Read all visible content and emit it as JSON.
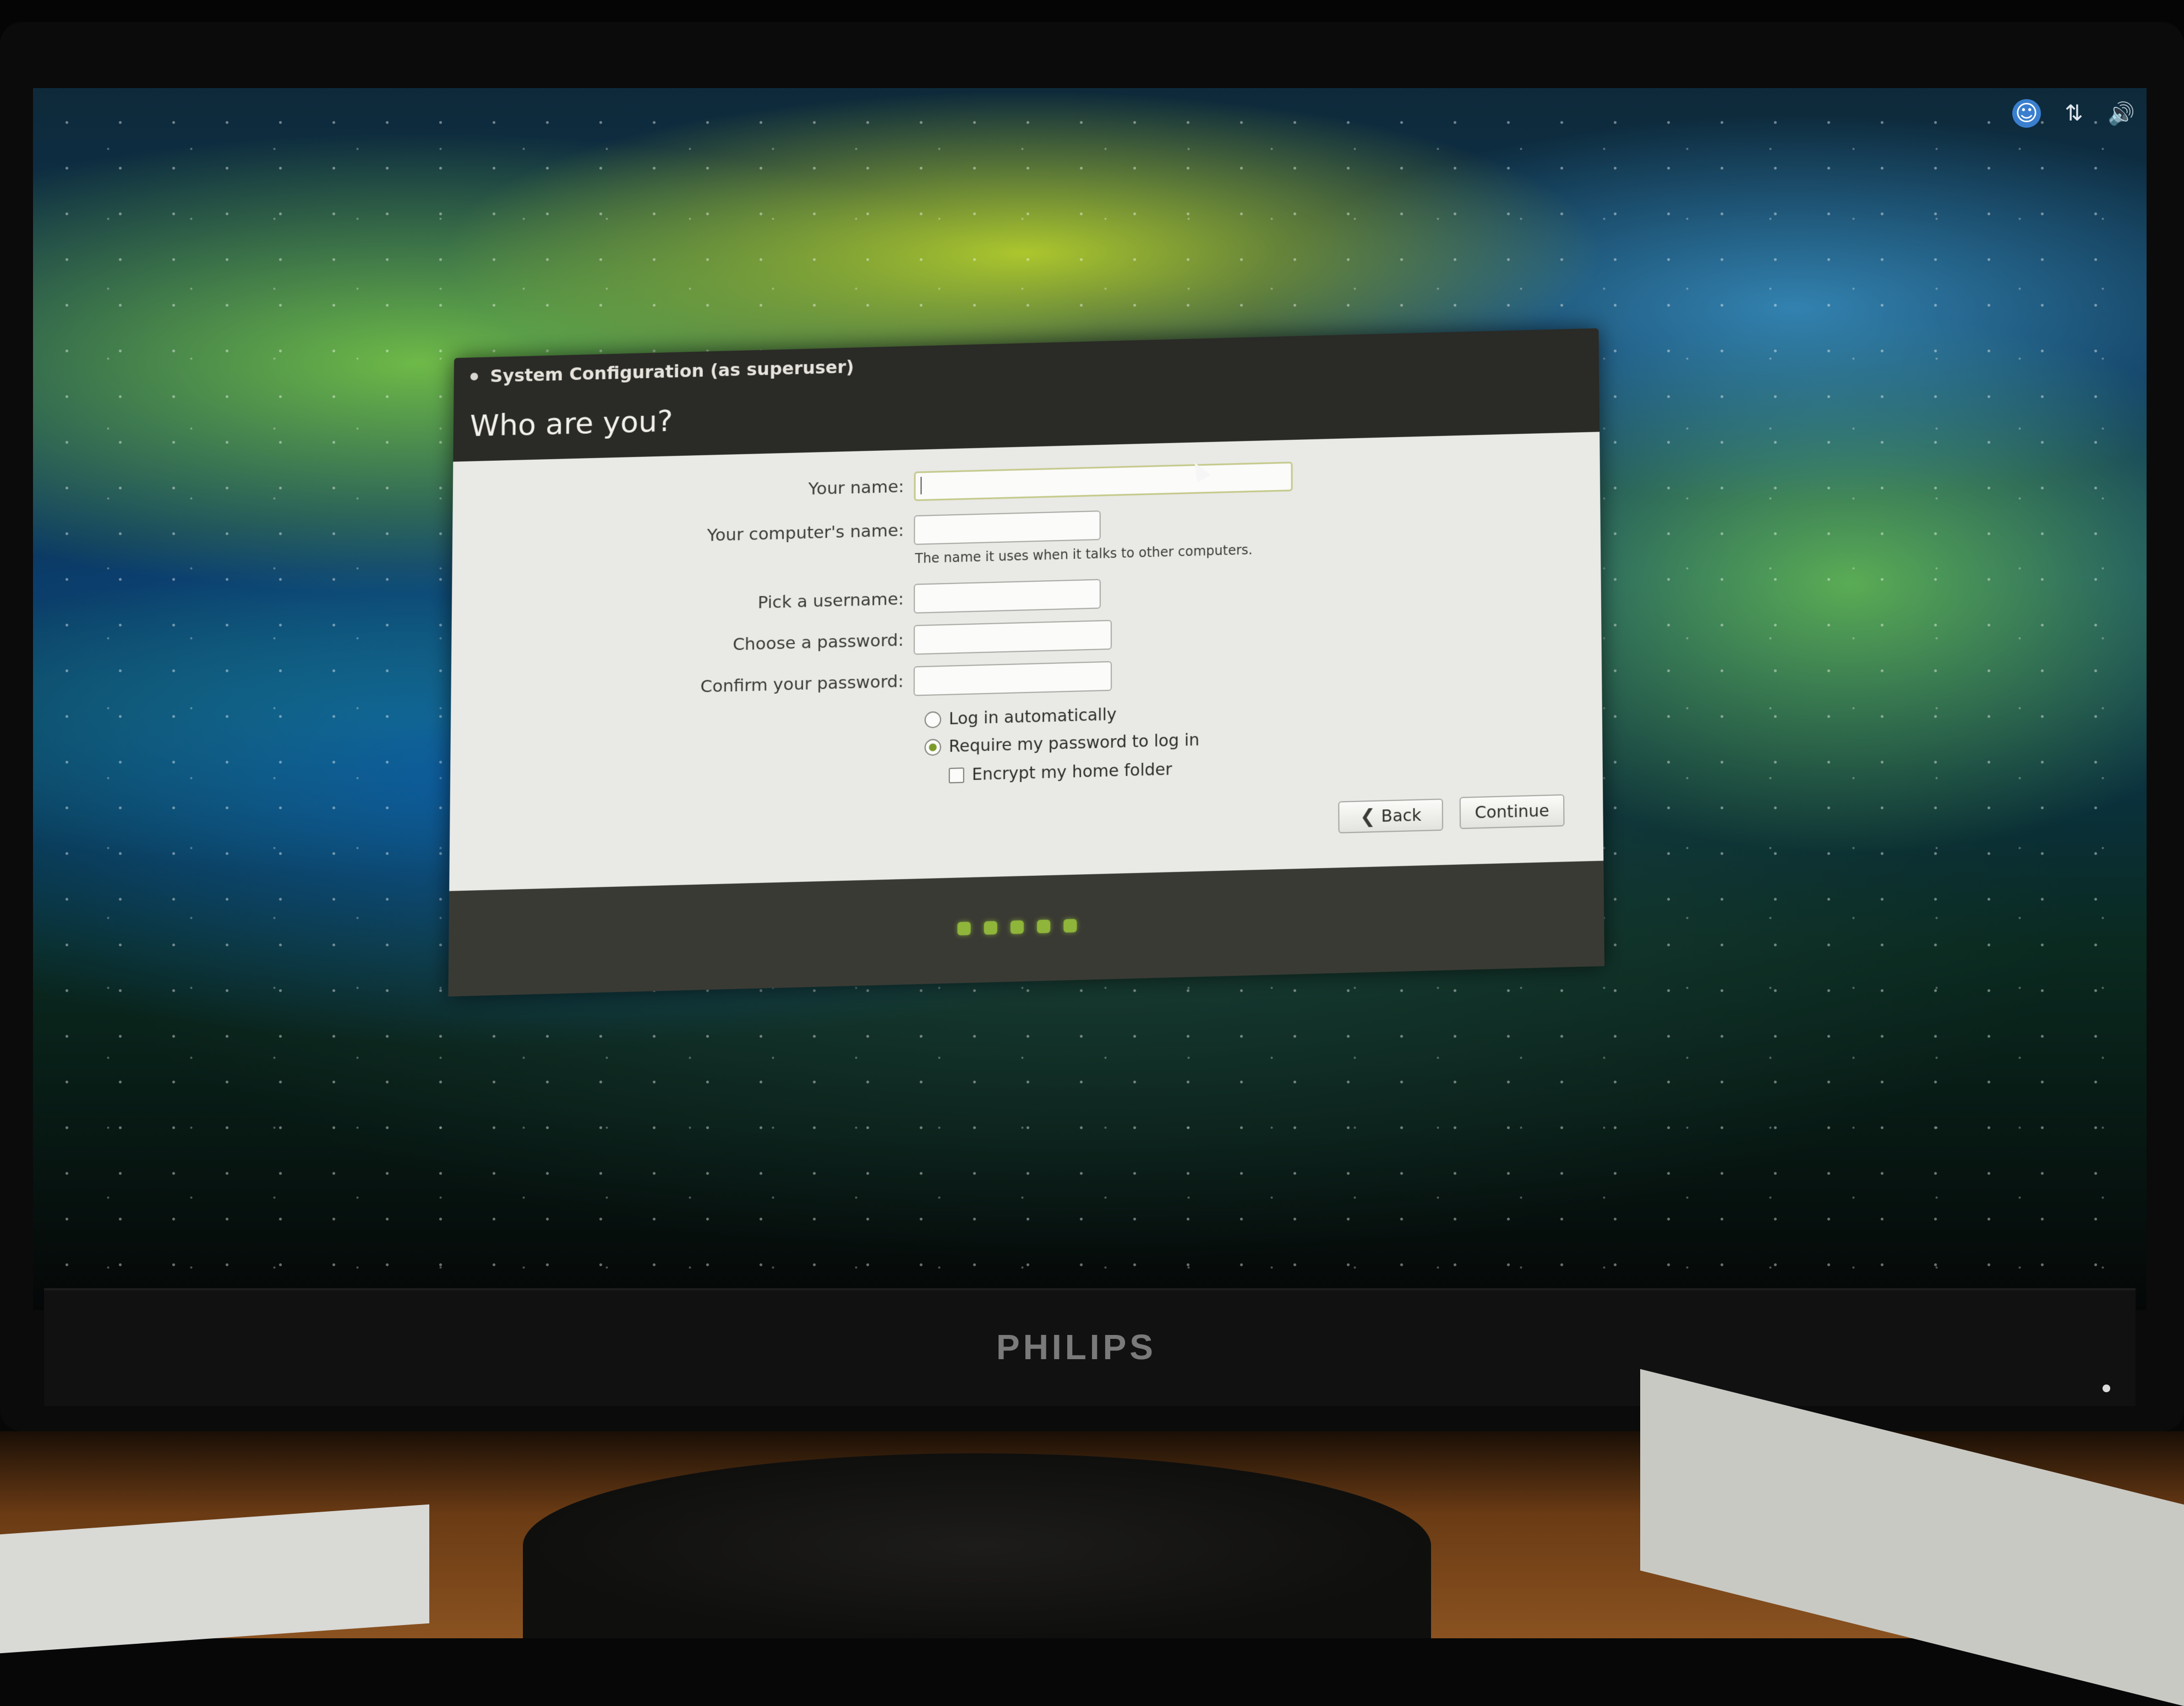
{
  "window": {
    "title": "System Configuration (as superuser)",
    "heading": "Who are you?"
  },
  "form": {
    "your_name_label": "Your name:",
    "your_name_value": "",
    "computer_name_label": "Your computer's name:",
    "computer_name_value": "",
    "computer_name_hint": "The name it uses when it talks to other computers.",
    "username_label": "Pick a username:",
    "username_value": "",
    "password_label": "Choose a password:",
    "password_value": "",
    "confirm_password_label": "Confirm your password:",
    "confirm_password_value": ""
  },
  "login_options": {
    "auto_login_label": "Log in automatically",
    "auto_login_selected": false,
    "require_password_label": "Require my password to log in",
    "require_password_selected": true,
    "encrypt_home_label": "Encrypt my home folder",
    "encrypt_home_checked": false
  },
  "buttons": {
    "back_label": "Back",
    "continue_label": "Continue"
  },
  "progress": {
    "total_steps": 5
  },
  "tray": {
    "icons": [
      "accessibility-icon",
      "network-icon",
      "volume-icon"
    ]
  },
  "monitor": {
    "brand": "PHILIPS"
  },
  "colors": {
    "accent_green": "#8fb53a",
    "dialog_dark": "#2a2a26",
    "content_bg": "#e9e9e6"
  }
}
